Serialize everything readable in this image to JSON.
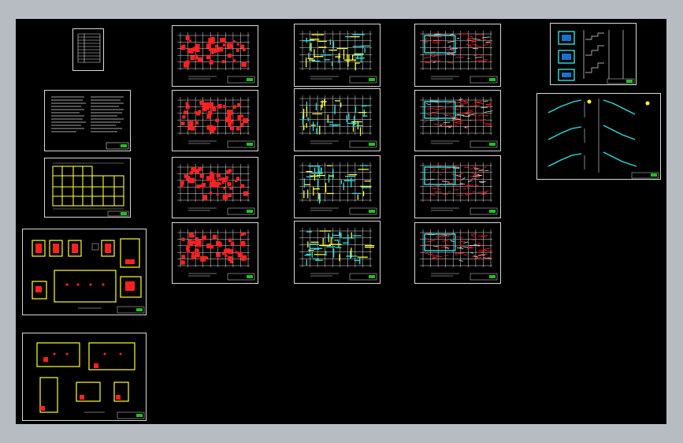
{
  "canvas": {
    "background": "#000000",
    "frame_color": "#b7bcc2"
  },
  "colors": {
    "sheet_border": "#d8d8d8",
    "grid_white": "#e0e0e0",
    "rebar_red": "#ff2020",
    "rebar_yellow": "#ffff33",
    "beam_cyan": "#33e0e0",
    "titleblock_green": "#22c022"
  },
  "columns": [
    {
      "id": "col1",
      "sheets": [
        "index-table",
        "design-notes",
        "foundation-plan",
        "column-detail-sheet-1",
        "column-detail-sheet-2"
      ]
    },
    {
      "id": "col2",
      "sheets": [
        "column-plan-1",
        "column-plan-2",
        "column-plan-3",
        "column-plan-4"
      ]
    },
    {
      "id": "col3",
      "sheets": [
        "beam-plan-1",
        "beam-plan-2",
        "beam-plan-3",
        "beam-plan-4"
      ]
    },
    {
      "id": "col4",
      "sheets": [
        "slab-plan-1",
        "slab-plan-2",
        "slab-plan-3",
        "slab-plan-4"
      ]
    },
    {
      "id": "col5",
      "sheets": [
        "stair-section",
        "stair-detail"
      ]
    }
  ]
}
